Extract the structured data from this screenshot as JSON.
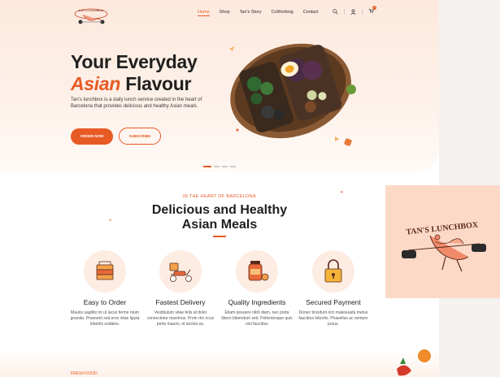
{
  "brand": {
    "logo_text": "TAN'S LUNCHBOX"
  },
  "nav": {
    "items": [
      "Home",
      "Shop",
      "Tan's Story",
      "CoWorking",
      "Contact"
    ],
    "active_index": 0
  },
  "header_icons": {
    "search": "search-icon",
    "user": "user-icon",
    "cart": "cart-icon",
    "cart_count": "0"
  },
  "hero": {
    "title_line1": "Your Everyday",
    "title_accent": "Asian",
    "title_rest": "Flavour",
    "description": "Tan's lunchbox is a daily lunch service created in the heart of Barcelona that provides delicious and healthy Asian meals.",
    "order_button": "ORDER NOW",
    "subscribe_button": "SUBSCRIBE",
    "slide_count": 4,
    "active_slide": 1
  },
  "section": {
    "kicker": "IN THE HEART OF BARCELONA",
    "title_line1": "Delicious and Healthy",
    "title_line2": "Asian Meals"
  },
  "features": [
    {
      "title": "Easy to Order",
      "icon": "lunchbox-icon",
      "desc": "Mauris sagittis mi ut lacus ferme ntum gravida. Praesent sed eros vitae ligula lobortis sodales."
    },
    {
      "title": "Fastest Delivery",
      "icon": "scooter-icon",
      "desc": "Vestibulum vitae felis at dolor consectetur maximus. Proin rho ncus porta mauris, et lacinia sa."
    },
    {
      "title": "Quality Ingredients",
      "icon": "jar-icon",
      "desc": "Etiam posuere nibh diam, nec porta libero bibendum sed. Pellentesque quis nisl faucibus"
    },
    {
      "title": "Secured Payment",
      "icon": "padlock-icon",
      "desc": "Donec tincidunt orci malesuada metus faucibus lobortis. Phasellus ac semper purus."
    }
  ],
  "next_section": {
    "kicker": "FRESH FOOD"
  },
  "logo_card": {
    "text": "TAN'S LUNCHBOX"
  },
  "colors": {
    "accent": "#e85a24",
    "hero_bg": "#fde9dd",
    "icon_circle": "#fdece2",
    "logo_card_bg": "#fcd9c7"
  }
}
